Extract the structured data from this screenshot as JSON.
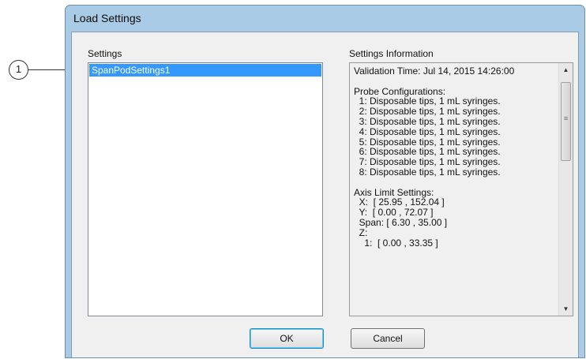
{
  "dialog": {
    "title": "Load Settings"
  },
  "callout": {
    "number": "1"
  },
  "settings": {
    "label": "Settings",
    "items": [
      "SpanPodSettings1"
    ]
  },
  "info": {
    "label": "Settings Information",
    "text": "Validation Time: Jul 14, 2015 14:26:00\n\nProbe Configurations:\n  1: Disposable tips, 1 mL syringes.\n  2: Disposable tips, 1 mL syringes.\n  3: Disposable tips, 1 mL syringes.\n  4: Disposable tips, 1 mL syringes.\n  5: Disposable tips, 1 mL syringes.\n  6: Disposable tips, 1 mL syringes.\n  7: Disposable tips, 1 mL syringes.\n  8: Disposable tips, 1 mL syringes.\n\nAxis Limit Settings:\n  X:  [ 25.95 , 152.04 ]\n  Y:  [ 0.00 , 72.07 ]\n  Span: [ 6.30 , 35.00 ]\n  Z:\n    1:  [ 0.00 , 33.35 ]"
  },
  "buttons": {
    "ok": "OK",
    "cancel": "Cancel"
  },
  "icons": {
    "scroll_up": "▲",
    "scroll_down": "▼",
    "grip": "≡"
  },
  "colors": {
    "selection": "#3399ff",
    "frame": "#a9cbe6"
  }
}
